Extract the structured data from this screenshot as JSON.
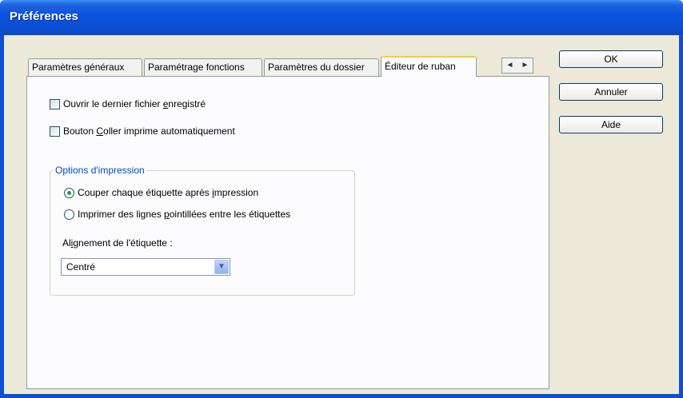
{
  "window": {
    "title": "Préférences"
  },
  "tabs": [
    {
      "label": "Paramètres généraux"
    },
    {
      "label": "Paramétrage fonctions"
    },
    {
      "label": "Paramètres du dossier"
    },
    {
      "label": "Éditeur de ruban",
      "active": true
    }
  ],
  "tab_nav": {
    "prev": "◄",
    "next": "►"
  },
  "buttons": {
    "ok": "OK",
    "cancel": "Annuler",
    "help": "Aide"
  },
  "checkboxes": [
    {
      "label_pre": "Ouvrir le dernier fichier ",
      "label_ul": "e",
      "label_post": "nregistré",
      "checked": false
    },
    {
      "label_pre": "Bouton ",
      "label_ul": "C",
      "label_post": "oller imprime automatiquement",
      "checked": false
    }
  ],
  "print_options": {
    "legend": "Options d'impression",
    "radios": [
      {
        "label_pre": "Couper chaque étiquette après ",
        "label_ul": "i",
        "label_post": "mpression",
        "checked": true
      },
      {
        "label_pre": "Imprimer des lignes ",
        "label_ul": "p",
        "label_post": "ointillées entre les étiquettes",
        "checked": false
      }
    ],
    "alignment_label_pre": "Al",
    "alignment_label_ul": "i",
    "alignment_label_post": "gnement de l'étiquette :",
    "alignment_value": "Centré"
  },
  "colors": {
    "title_bar": "#0a4fd6",
    "active_tab_highlight": "#ffc83c",
    "legend_text": "#0046d5",
    "radio_dot": "#21a121"
  }
}
